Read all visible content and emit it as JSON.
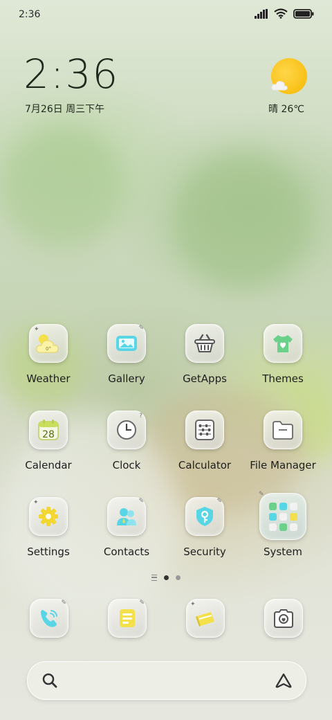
{
  "status_bar": {
    "time": "2:36"
  },
  "clock_widget": {
    "time": "2:36",
    "date": "7月26日 周三下午"
  },
  "weather_widget": {
    "text": "晴 26℃"
  },
  "apps": [
    {
      "label": "Weather",
      "icon": "weather-cloud-sun-icon"
    },
    {
      "label": "Gallery",
      "icon": "gallery-picture-icon"
    },
    {
      "label": "GetApps",
      "icon": "shopping-basket-icon"
    },
    {
      "label": "Themes",
      "icon": "tshirt-heart-icon"
    },
    {
      "label": "Calendar",
      "icon": "calendar-icon",
      "icon_text": "28"
    },
    {
      "label": "Clock",
      "icon": "clock-icon"
    },
    {
      "label": "Calculator",
      "icon": "calculator-abacus-icon"
    },
    {
      "label": "File Manager",
      "icon": "folder-icon"
    },
    {
      "label": "Settings",
      "icon": "gear-icon"
    },
    {
      "label": "Contacts",
      "icon": "contacts-people-icon"
    },
    {
      "label": "Security",
      "icon": "shield-key-icon"
    },
    {
      "label": "System",
      "icon": "system-folder-icon"
    }
  ],
  "weather_icon_text": "0°",
  "dock": [
    {
      "icon": "phone-icon"
    },
    {
      "icon": "messages-icon"
    },
    {
      "icon": "browser-icon"
    },
    {
      "icon": "camera-icon"
    }
  ],
  "page_indicator": {
    "pages": 2,
    "current": 1
  },
  "search_bar": {
    "left_icon": "search-icon",
    "right_icon": "assistant-icon"
  },
  "colors": {
    "accent_yellow": "#f5c400",
    "icon_yellow": "#f4e04a",
    "icon_cyan": "#58d6e6",
    "icon_green": "#6ad08a"
  }
}
